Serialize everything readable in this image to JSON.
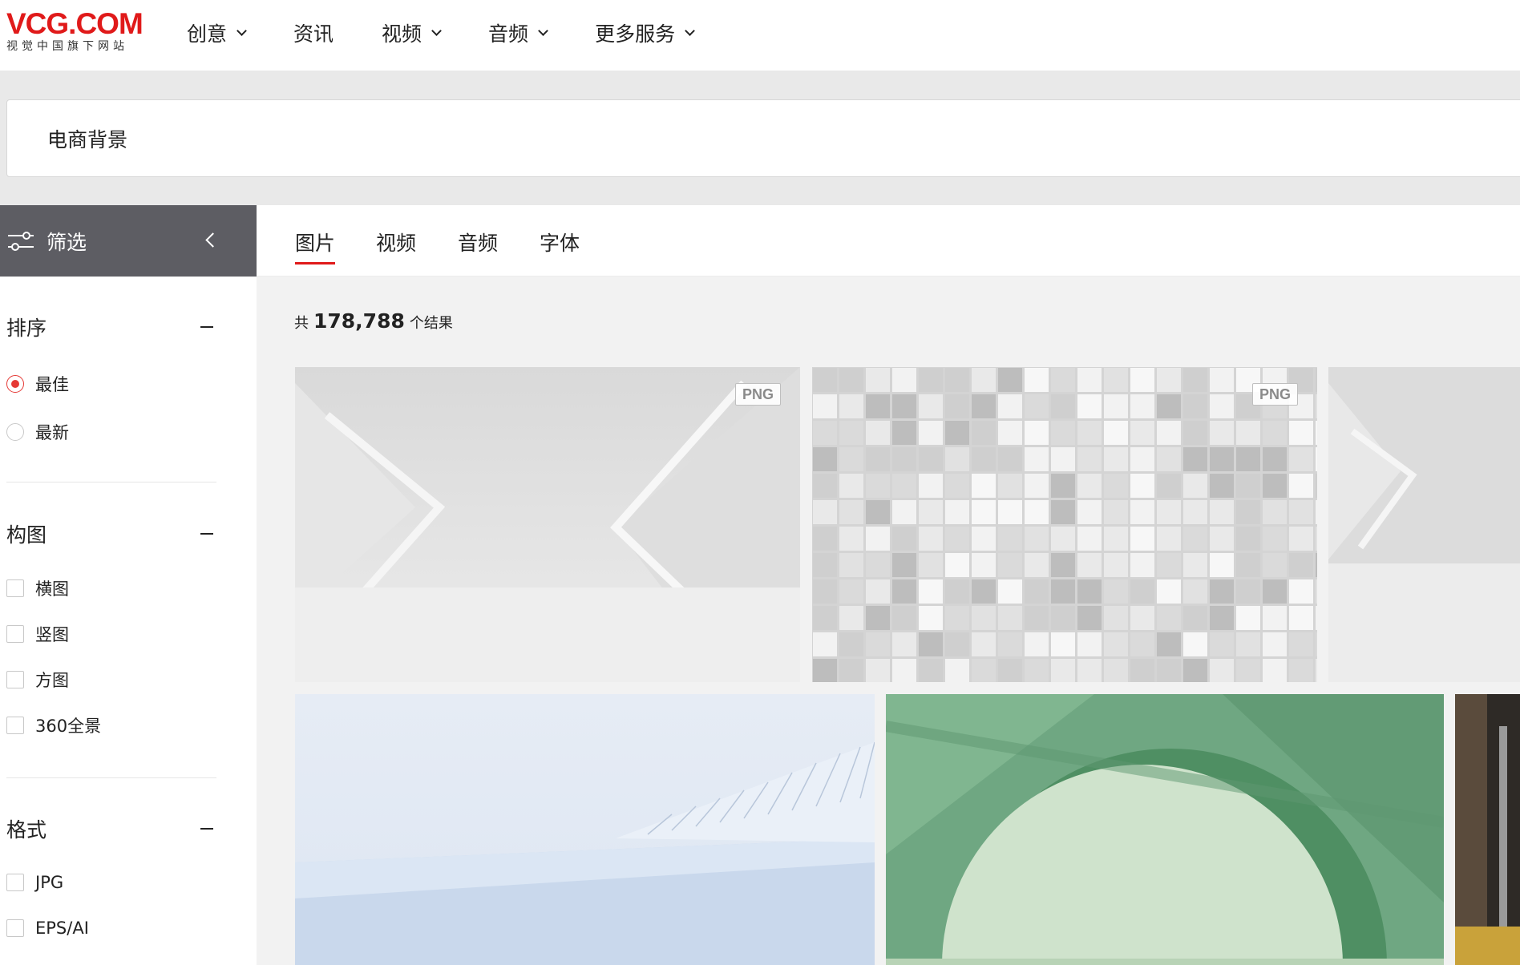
{
  "logo": {
    "main": "VCG.COM",
    "sub": "视觉中国旗下网站"
  },
  "nav": {
    "items": [
      {
        "label": "创意",
        "dropdown": true
      },
      {
        "label": "资讯",
        "dropdown": false
      },
      {
        "label": "视频",
        "dropdown": true
      },
      {
        "label": "音频",
        "dropdown": true
      },
      {
        "label": "更多服务",
        "dropdown": true
      }
    ]
  },
  "search": {
    "value": "电商背景"
  },
  "filter": {
    "label": "筛选",
    "sections": [
      {
        "title": "排序",
        "options": [
          "最佳",
          "最新"
        ],
        "selected": "最佳"
      },
      {
        "title": "构图",
        "options": [
          "横图",
          "竖图",
          "方图",
          "360全景"
        ]
      },
      {
        "title": "格式",
        "options": [
          "JPG",
          "EPS/AI"
        ]
      }
    ]
  },
  "tabs": [
    "图片",
    "视频",
    "音频",
    "字体"
  ],
  "active_tab": "图片",
  "results": {
    "prefix": "共",
    "count": "178,788",
    "suffix": "个结果"
  },
  "images": [
    {
      "badge": "PNG"
    },
    {
      "badge": "PNG"
    },
    {
      "badge": ""
    },
    {
      "badge": ""
    },
    {
      "badge": ""
    },
    {
      "badge": ""
    }
  ],
  "colors": {
    "brand": "#e01a1a",
    "filter_header_bg": "#5d5d63",
    "page_bg": "#f2f2f2"
  }
}
